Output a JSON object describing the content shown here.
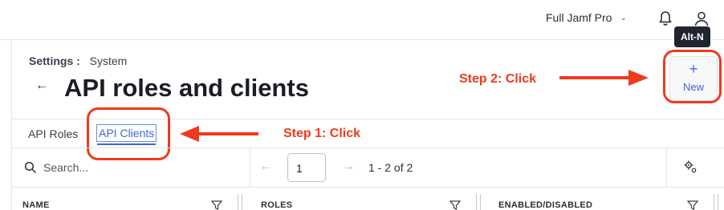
{
  "header": {
    "environment_label": "Full Jamf Pro",
    "new_tooltip": "Alt-N"
  },
  "breadcrumb": {
    "section": "Settings :",
    "page": "System"
  },
  "page": {
    "title": "API roles and clients",
    "new_plus": "+",
    "new_label": "New"
  },
  "annotations": {
    "step1": "Step 1: Click",
    "step2": "Step 2: Click",
    "color": "#ee3a1e"
  },
  "tabs": [
    {
      "label": "API Roles",
      "active": false
    },
    {
      "label": "API Clients",
      "active": true
    }
  ],
  "toolbar": {
    "search_placeholder": "Search...",
    "page_input": "1",
    "page_count": "1 - 2 of 2"
  },
  "table": {
    "columns": [
      "NAME",
      "ROLES",
      "ENABLED/DISABLED"
    ]
  },
  "colors": {
    "accent": "#3d66d6",
    "annotation": "#ee3a1e"
  }
}
